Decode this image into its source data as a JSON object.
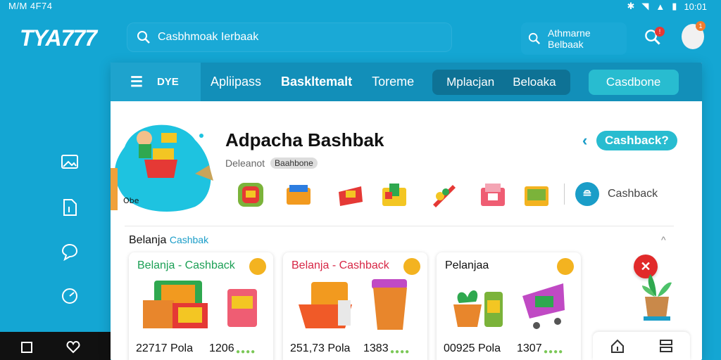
{
  "status": {
    "left": "M/M 4F74",
    "right_time": "10:01"
  },
  "app": {
    "logo": "TYA777"
  },
  "search": {
    "query": "Casbhmoak Ierbaak"
  },
  "account": {
    "line1": "Athmarne",
    "line2": "Belbaak"
  },
  "tabs": {
    "menu_label": "DYE",
    "items": [
      "Apliipass",
      "Baskltemalt",
      "Toreme"
    ],
    "group": [
      "Mplacjan",
      "Beloaka"
    ],
    "cta": "Casdbone"
  },
  "header": {
    "hero_text": "Obe",
    "title": "Adpacha Bashbak",
    "subtitle": "Deleanot",
    "subtitle_badge": "Baahbone",
    "cashback_pill": "Cashback?",
    "cashback_chip": "Cashback"
  },
  "section": {
    "label": "Belanja",
    "accent": "Cashbak"
  },
  "cards": [
    {
      "title": "Belanja - Cashback",
      "price": "22717 Pola",
      "count": "1206",
      "title_color": "#1b9f55"
    },
    {
      "title": "Belanja - Cashback",
      "price": "251,73 Pola",
      "count": "1383",
      "title_color": "#d72645"
    },
    {
      "title": "Pelanjaa",
      "price": "00925 Pola",
      "count": "1307",
      "title_color": "#111111"
    }
  ],
  "colors": {
    "brand": "#14a6d3",
    "tab_bar": "#128fb9",
    "accent": "#28bcd0"
  }
}
